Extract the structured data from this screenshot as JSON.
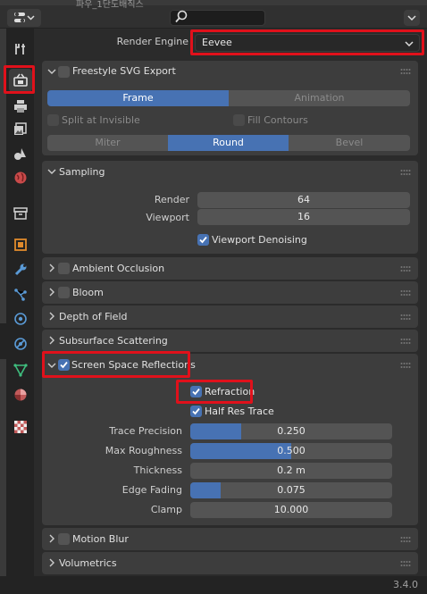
{
  "topbar": {
    "behind_text": "파우_1단도배직스"
  },
  "render_engine": {
    "label": "Render Engine",
    "value": "Eevee"
  },
  "freestyle": {
    "title": "Freestyle SVG Export",
    "tabs": [
      "Frame",
      "Animation"
    ],
    "split_label": "Split at Invisible",
    "fill_label": "Fill Contours",
    "joins": [
      "Miter",
      "Round",
      "Bevel"
    ]
  },
  "sampling": {
    "title": "Sampling",
    "render_label": "Render",
    "render_value": "64",
    "viewport_label": "Viewport",
    "viewport_value": "16",
    "denoise_label": "Viewport Denoising"
  },
  "ao": {
    "title": "Ambient Occlusion"
  },
  "bloom": {
    "title": "Bloom"
  },
  "dof": {
    "title": "Depth of Field"
  },
  "sss": {
    "title": "Subsurface Scattering"
  },
  "ssr": {
    "title": "Screen Space Reflections",
    "refraction_label": "Refraction",
    "half_res_label": "Half Res Trace",
    "fields": [
      {
        "label": "Trace Precision",
        "value": "0.250",
        "fill": 0.25
      },
      {
        "label": "Max Roughness",
        "value": "0.500",
        "fill": 0.5
      },
      {
        "label": "Thickness",
        "value": "0.2 m",
        "fill": 0
      },
      {
        "label": "Edge Fading",
        "value": "0.075",
        "fill": 0.15
      },
      {
        "label": "Clamp",
        "value": "10.000",
        "fill": 0
      }
    ]
  },
  "motion_blur": {
    "title": "Motion Blur"
  },
  "volumetrics": {
    "title": "Volumetrics"
  },
  "status": {
    "version": "3.4.0"
  },
  "colors": {
    "accent": "#4772b3",
    "highlight": "#e0111b"
  }
}
